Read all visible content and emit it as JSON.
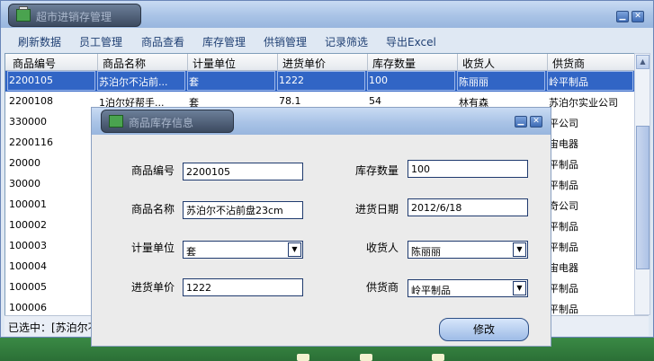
{
  "main_window": {
    "title": "超市进销存管理",
    "menu": [
      "刷新数据",
      "员工管理",
      "商品查看",
      "库存管理",
      "供销管理",
      "记录筛选",
      "导出Excel"
    ]
  },
  "table": {
    "columns": [
      "商品编号",
      "商品名称",
      "计量单位",
      "进货单价",
      "库存数量",
      "收货人",
      "供货商"
    ],
    "rows": [
      [
        "2200105",
        "苏泊尔不沾前...",
        "套",
        "1222",
        "100",
        "陈丽丽",
        "岭平制品"
      ],
      [
        "2200108",
        "1泊尔好帮手...",
        "套",
        "78.1",
        "54",
        "林有森",
        "苏泊尔实业公司"
      ],
      [
        "330000",
        "",
        "",
        "",
        "",
        "",
        "平公司"
      ],
      [
        "2200116",
        "",
        "",
        "",
        "",
        "",
        "宙电器"
      ],
      [
        "20000",
        "",
        "",
        "",
        "",
        "",
        "平制品"
      ],
      [
        "30000",
        "",
        "",
        "",
        "",
        "",
        "平制品"
      ],
      [
        "100001",
        "",
        "",
        "",
        "",
        "",
        "奇公司"
      ],
      [
        "100002",
        "",
        "",
        "",
        "",
        "",
        "平制品"
      ],
      [
        "100003",
        "",
        "",
        "",
        "",
        "",
        "平制品"
      ],
      [
        "100004",
        "",
        "",
        "",
        "",
        "",
        "宙电器"
      ],
      [
        "100005",
        "",
        "",
        "",
        "",
        "",
        "平制品"
      ],
      [
        "100006",
        "",
        "",
        "",
        "",
        "",
        "平制品"
      ]
    ]
  },
  "status": {
    "text": "已选中：[苏泊尔不"
  },
  "dialog": {
    "title": "商品库存信息",
    "fields": {
      "code_label": "商品编号",
      "code_value": "2200105",
      "name_label": "商品名称",
      "name_value": "苏泊尔不沾前盘23cm",
      "unit_label": "计量单位",
      "unit_value": "套",
      "price_label": "进货单价",
      "price_value": "1222",
      "qty_label": "库存数量",
      "qty_value": "100",
      "date_label": "进货日期",
      "date_value": "2012/6/18",
      "receiver_label": "收货人",
      "receiver_value": "陈丽丽",
      "supplier_label": "供货商",
      "supplier_value": "岭平制品"
    },
    "modify_label": "修改"
  },
  "icons": {
    "minimize": "minimize-icon",
    "close": "close-icon",
    "app": "app-icon",
    "dropdown": "chevron-down-icon"
  },
  "colors": {
    "selection": "#3165c5",
    "title_gradient_top": "#c9dbf3",
    "menu_text": "#1f3f73",
    "desktop": "#2f7a3a"
  }
}
